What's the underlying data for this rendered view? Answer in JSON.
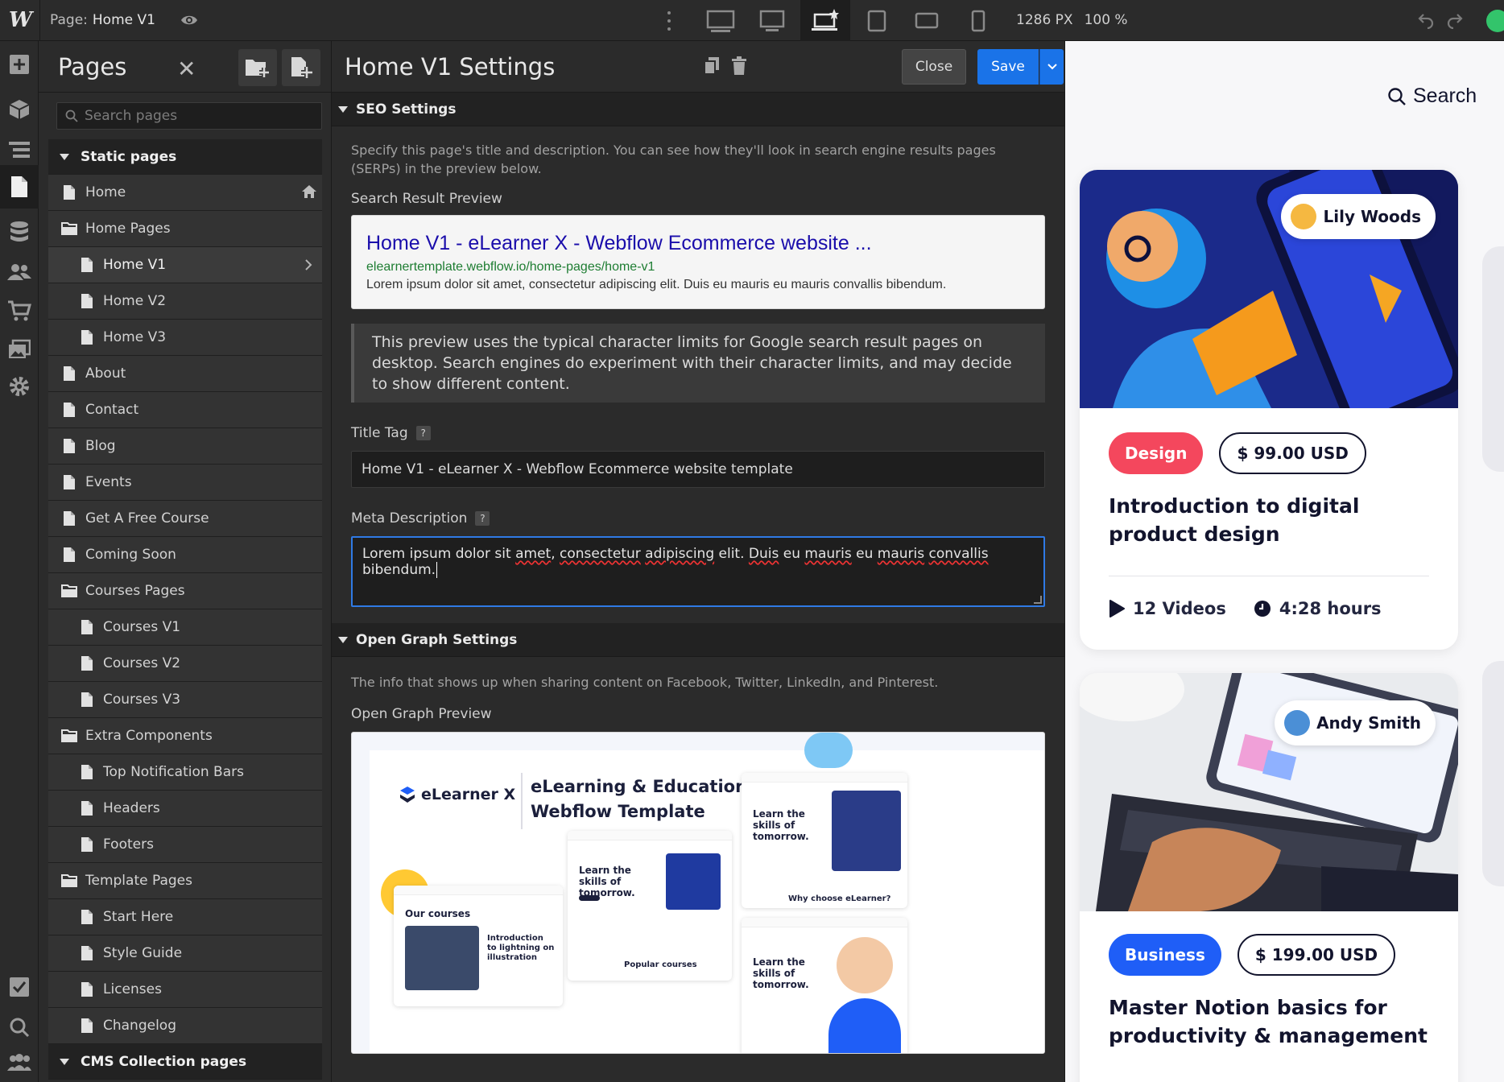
{
  "topbar": {
    "page_prefix": "Page:",
    "page_name": "Home V1",
    "width_px": "1286 PX",
    "zoom": "100 %"
  },
  "pages_panel": {
    "title": "Pages",
    "search_placeholder": "Search pages",
    "static_section": "Static pages",
    "cms_section": "CMS Collection pages",
    "items": [
      {
        "label": "Home",
        "type": "page",
        "indent": 0,
        "home": true
      },
      {
        "label": "Home Pages",
        "type": "folder",
        "indent": 0
      },
      {
        "label": "Home V1",
        "type": "page",
        "indent": 1,
        "selected": true
      },
      {
        "label": "Home V2",
        "type": "page",
        "indent": 1
      },
      {
        "label": "Home V3",
        "type": "page",
        "indent": 1
      },
      {
        "label": "About",
        "type": "page",
        "indent": 0
      },
      {
        "label": "Contact",
        "type": "page",
        "indent": 0
      },
      {
        "label": "Blog",
        "type": "page",
        "indent": 0
      },
      {
        "label": "Events",
        "type": "page",
        "indent": 0
      },
      {
        "label": "Get A Free Course",
        "type": "page",
        "indent": 0
      },
      {
        "label": "Coming Soon",
        "type": "page",
        "indent": 0
      },
      {
        "label": "Courses Pages",
        "type": "folder",
        "indent": 0
      },
      {
        "label": "Courses V1",
        "type": "page",
        "indent": 1
      },
      {
        "label": "Courses V2",
        "type": "page",
        "indent": 1
      },
      {
        "label": "Courses V3",
        "type": "page",
        "indent": 1
      },
      {
        "label": "Extra Components",
        "type": "folder",
        "indent": 0
      },
      {
        "label": "Top Notification Bars",
        "type": "page",
        "indent": 1
      },
      {
        "label": "Headers",
        "type": "page",
        "indent": 1
      },
      {
        "label": "Footers",
        "type": "page",
        "indent": 1
      },
      {
        "label": "Template Pages",
        "type": "folder",
        "indent": 0
      },
      {
        "label": "Start Here",
        "type": "page",
        "indent": 1
      },
      {
        "label": "Style Guide",
        "type": "page",
        "indent": 1
      },
      {
        "label": "Licenses",
        "type": "page",
        "indent": 1
      },
      {
        "label": "Changelog",
        "type": "page",
        "indent": 1
      }
    ]
  },
  "settings": {
    "title": "Home V1 Settings",
    "close_label": "Close",
    "save_label": "Save",
    "seo": {
      "heading": "SEO Settings",
      "intro": "Specify this page's title and description. You can see how they'll look in search engine results pages (SERPs) in the preview below.",
      "preview_label": "Search Result Preview",
      "serp_title": "Home V1 - eLearner X - Webflow Ecommerce website ...",
      "serp_url": "elearnertemplate.webflow.io/home-pages/home-v1",
      "serp_desc": "Lorem ipsum dolor sit amet, consectetur adipiscing elit. Duis eu mauris eu mauris convallis bibendum.",
      "note": "This preview uses the typical character limits for Google search result pages on desktop. Search engines do experiment with their character limits, and may decide to show different content.",
      "title_tag_label": "Title Tag",
      "title_tag_value": "Home V1 - eLearner X - Webflow Ecommerce website template",
      "meta_label": "Meta Description",
      "meta_parts": [
        "Lorem ipsum dolor sit ",
        "amet",
        ", ",
        "consectetur",
        " ",
        "adipiscing",
        " elit. ",
        "Duis",
        " eu ",
        "mauris",
        " eu ",
        "mauris",
        " ",
        "convallis",
        " bibendum."
      ],
      "help": "?"
    },
    "og": {
      "heading": "Open Graph Settings",
      "intro": "The info that shows up when sharing content on Facebook, Twitter, LinkedIn, and Pinterest.",
      "preview_label": "Open Graph Preview",
      "brand": "eLearner X",
      "headline_1": "eLearning & Education",
      "headline_2": "Webflow Template",
      "mini_1": "Learn the skills of tomorrow.",
      "mini_2": "Our courses",
      "mini_3": "Introduction to lightning on illustration",
      "mini_4": "Why choose eLearner?",
      "mini_5": "Popular courses"
    }
  },
  "canvas": {
    "search_label": "Search",
    "cards": [
      {
        "author": "Lily Woods",
        "tag": "Design",
        "tag_color": "#f4475d",
        "price": "$ 99.00 USD",
        "title": "Introduction to digital product design",
        "videos": "12 Videos",
        "hours": "4:28 hours"
      },
      {
        "author": "Andy Smith",
        "tag": "Business",
        "tag_color": "#1f5ef7",
        "price": "$ 199.00 USD",
        "title": "Master Notion basics for productivity & management"
      }
    ]
  },
  "colors": {
    "accent": "#1a73e8",
    "bg_dark": "#2b2b2b",
    "panel": "#1e1e1e"
  }
}
